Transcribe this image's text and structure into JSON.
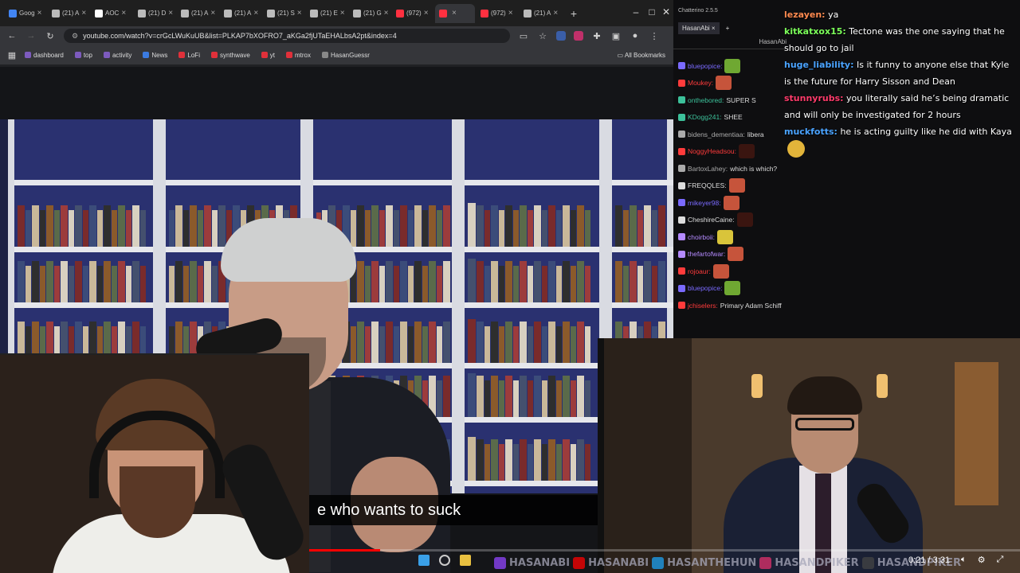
{
  "browser": {
    "tabs": [
      {
        "label": "Goog",
        "color": "#4285f4"
      },
      {
        "label": "(21) A",
        "color": "#bbbbbb"
      },
      {
        "label": "AOC",
        "color": "#ffffff"
      },
      {
        "label": "(21) D",
        "color": "#bbbbbb"
      },
      {
        "label": "(21) A",
        "color": "#bbbbbb"
      },
      {
        "label": "(21) A",
        "color": "#bbbbbb"
      },
      {
        "label": "(21) S",
        "color": "#bbbbbb"
      },
      {
        "label": "(21) E",
        "color": "#bbbbbb"
      },
      {
        "label": "(21) G",
        "color": "#bbbbbb"
      },
      {
        "label": "(972)",
        "color": "#ff3040"
      },
      {
        "label": "",
        "color": "#ff3040",
        "active": true
      },
      {
        "label": "(972)",
        "color": "#ff3040"
      },
      {
        "label": "(21) A",
        "color": "#bbbbbb"
      }
    ],
    "new_tab": "+",
    "url": "youtube.com/watch?v=crGcLWuKuUB&list=PLKAP7bXOFRO7_aKGa2fjUTaEHALbsA2pt&index=4",
    "bookmarks": [
      {
        "label": "dashboard",
        "color": "#7d5bbe"
      },
      {
        "label": "top",
        "color": "#7d5bbe"
      },
      {
        "label": "activity",
        "color": "#7d5bbe"
      },
      {
        "label": "News",
        "color": "#3b7be0"
      },
      {
        "label": "LoFi",
        "color": "#e0303a"
      },
      {
        "label": "synthwave",
        "color": "#e0303a"
      },
      {
        "label": "yt",
        "color": "#e0303a"
      },
      {
        "label": "mtrox",
        "color": "#e0303a"
      },
      {
        "label": "HasanGuessr",
        "color": "#888888"
      }
    ],
    "all_bookmarks": "All Bookmarks"
  },
  "video": {
    "subtitle": "e who wants to suck",
    "time_current": "0:21",
    "time_sep": "/",
    "time_total": "3:31",
    "progress": 0.0995
  },
  "chatterino": {
    "title": "Chatterino 2.5.5",
    "tab_label": "HasanAbi",
    "tab_close": "×",
    "tab_add": "+",
    "channel_header": "HasanAbi",
    "messages": [
      {
        "user": "bluepopice:",
        "color": "#7a6aff",
        "text": "",
        "emote": "#6fa832"
      },
      {
        "user": "Moukey:",
        "color": "#ff3b3b",
        "text": "",
        "emote": "#c6543b"
      },
      {
        "user": "onthebored:",
        "color": "#3cc19a",
        "text": "SUPER S",
        "emote": ""
      },
      {
        "user": "KDogg241:",
        "color": "#3cc19a",
        "text": "SHEE",
        "emote": ""
      },
      {
        "user": "bidens_dementiaa:",
        "color": "#aaaaaa",
        "text": "libera",
        "emote": ""
      },
      {
        "user": "NoggyHeadsou:",
        "color": "#ff3b3b",
        "text": "",
        "emote": "#3a1510"
      },
      {
        "user": "BartoxLahey:",
        "color": "#aaaaaa",
        "text": "which is which?",
        "emote": ""
      },
      {
        "user": "FREQQLES:",
        "color": "#dddddd",
        "text": "",
        "emote": "#c6543b"
      },
      {
        "user": "mikeyer98:",
        "color": "#7a6aff",
        "text": "",
        "emote": "#c6543b"
      },
      {
        "user": "CheshireCaine:",
        "color": "#dddddd",
        "text": "",
        "emote": "#3a1510"
      },
      {
        "user": "choirboii:",
        "color": "#b48aff",
        "text": "",
        "emote": "#d9c43a"
      },
      {
        "user": "thefartofwar:",
        "color": "#b48aff",
        "text": "",
        "emote": "#c6543b"
      },
      {
        "user": "rojoaur:",
        "color": "#ff3b3b",
        "text": "",
        "emote": "#c6543b"
      },
      {
        "user": "bluepopice:",
        "color": "#7a6aff",
        "text": "",
        "emote": "#6fa832"
      },
      {
        "user": "jchiselers:",
        "color": "#ff3b3b",
        "text": "Primary Adam Schiff",
        "emote": ""
      }
    ]
  },
  "stream_chat": [
    {
      "user": "lezayen:",
      "color": "#ff8a50",
      "text": "ya"
    },
    {
      "user": "kitkatxox15:",
      "color": "#7cff5a",
      "text": "Tectone was the one saying that he should go to jail"
    },
    {
      "user": "huge_liability:",
      "color": "#4aa3ff",
      "text": "Is it funny to anyone else that Kyle is the future for Harry Sisson and Dean"
    },
    {
      "user": "stunnyrubs:",
      "color": "#ff3b6b",
      "text": "you literally said he’s being dramatic and will only be investigated for 2 hours"
    },
    {
      "user": "muckfotts:",
      "color": "#4aa3ff",
      "text": "he is acting guilty like he did with Kaya",
      "emote": true
    }
  ],
  "socials": [
    {
      "icon": "twitch-icon",
      "color": "#9146ff",
      "handle": "HASANABI"
    },
    {
      "icon": "youtube-icon",
      "color": "#ff0000",
      "handle": "HASANABI"
    },
    {
      "icon": "twitter-icon",
      "color": "#1da1f2",
      "handle": "HASANTHEHUN"
    },
    {
      "icon": "instagram-icon",
      "color": "#e1306c",
      "handle": "HASANDPIKER"
    },
    {
      "icon": "tiktok-icon",
      "color": "#444444",
      "handle": "HASANDPIKER"
    }
  ]
}
